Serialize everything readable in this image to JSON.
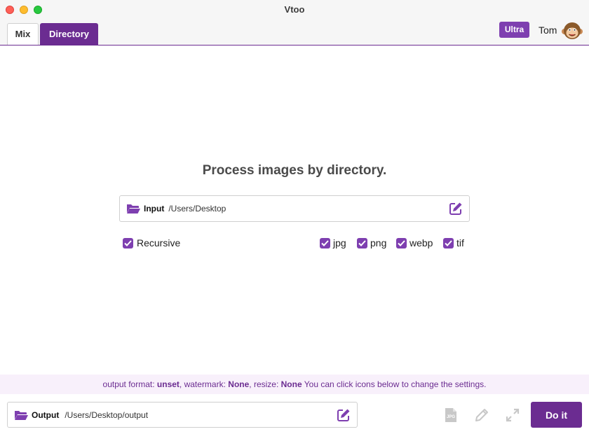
{
  "window": {
    "title": "Vtoo"
  },
  "tabs": [
    {
      "label": "Mix",
      "active": false
    },
    {
      "label": "Directory",
      "active": true
    }
  ],
  "account": {
    "badge": "Ultra",
    "user_name": "Tom",
    "avatar_icon": "monkey-avatar-icon"
  },
  "main": {
    "heading": "Process images by directory.",
    "input": {
      "label": "Input",
      "path": "/Users/Desktop",
      "folder_icon": "folder-open-icon",
      "edit_icon": "edit-icon"
    },
    "recursive": {
      "label": "Recursive",
      "checked": true
    },
    "formats": [
      {
        "label": "jpg",
        "checked": true
      },
      {
        "label": "png",
        "checked": true
      },
      {
        "label": "webp",
        "checked": true
      },
      {
        "label": "tif",
        "checked": true
      }
    ]
  },
  "status": {
    "format_label": "output format:",
    "format_value": "unset",
    "watermark_label": ", watermark:",
    "watermark_value": "None",
    "resize_label": ", resize:",
    "resize_value": "None",
    "hint": "You can click icons below to change the settings."
  },
  "footer": {
    "output": {
      "label": "Output",
      "path": "/Users/Desktop/output"
    },
    "tools": [
      "jpg-format-icon",
      "pencil-icon",
      "resize-icon"
    ],
    "do_it_label": "Do it"
  },
  "colors": {
    "accent": "#6b2c91",
    "checkbox": "#7e3fb0",
    "status_bg": "#f8f0fb"
  }
}
